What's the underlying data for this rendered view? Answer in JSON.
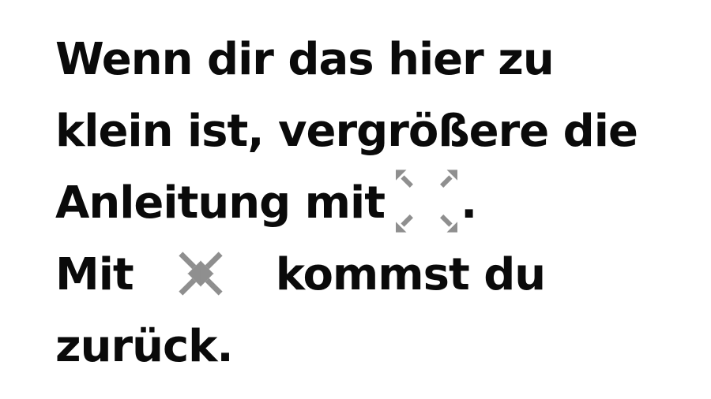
{
  "instruction": {
    "line1": "Wenn dir das hier zu",
    "line2": "klein ist, vergrößere die",
    "line3_before": "Anleitung mit",
    "line3_after": ".",
    "line4_before": "Mit",
    "line4_after": "kommst du",
    "line5": "zurück."
  },
  "icons": {
    "expand": "fullscreen-expand-icon",
    "collapse": "fullscreen-collapse-icon",
    "color": "#8f8f8f"
  }
}
